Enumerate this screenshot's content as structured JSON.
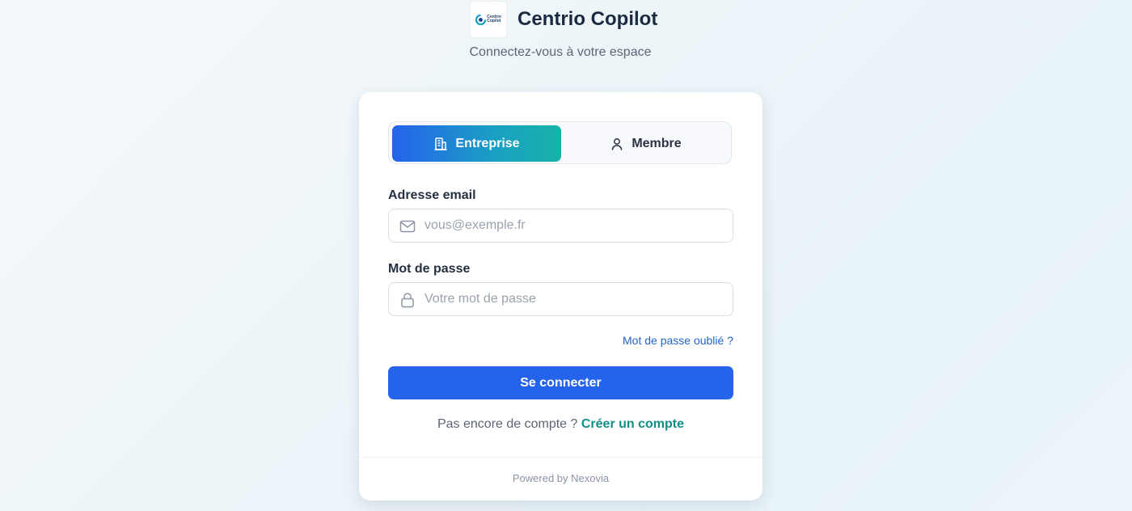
{
  "brand": {
    "title": "Centrio Copilot",
    "logo_text_line1": "Centrio",
    "logo_text_line2": "Copilot",
    "subtitle": "Connectez-vous à votre espace"
  },
  "account_type": {
    "options": [
      {
        "label": "Entreprise",
        "icon": "building-icon",
        "selected": true
      },
      {
        "label": "Membre",
        "icon": "user-icon",
        "selected": false
      }
    ]
  },
  "form": {
    "email": {
      "label": "Adresse email",
      "placeholder": "vous@exemple.fr",
      "value": "",
      "icon": "mail-icon"
    },
    "password": {
      "label": "Mot de passe",
      "placeholder": "Votre mot de passe",
      "value": "",
      "icon": "lock-icon"
    },
    "forgot_label": "Mot de passe oublié ?",
    "submit_label": "Se connecter",
    "signup_prompt": "Pas encore de compte ?",
    "signup_link": "Créer un compte"
  },
  "footer": {
    "powered_by": "Powered by Nexovia"
  },
  "colors": {
    "primary": "#2563eb",
    "accent_teal": "#17b3a8",
    "link_teal": "#0f8f86",
    "link_blue": "#2563c9",
    "title_dark": "#1b2a41"
  }
}
